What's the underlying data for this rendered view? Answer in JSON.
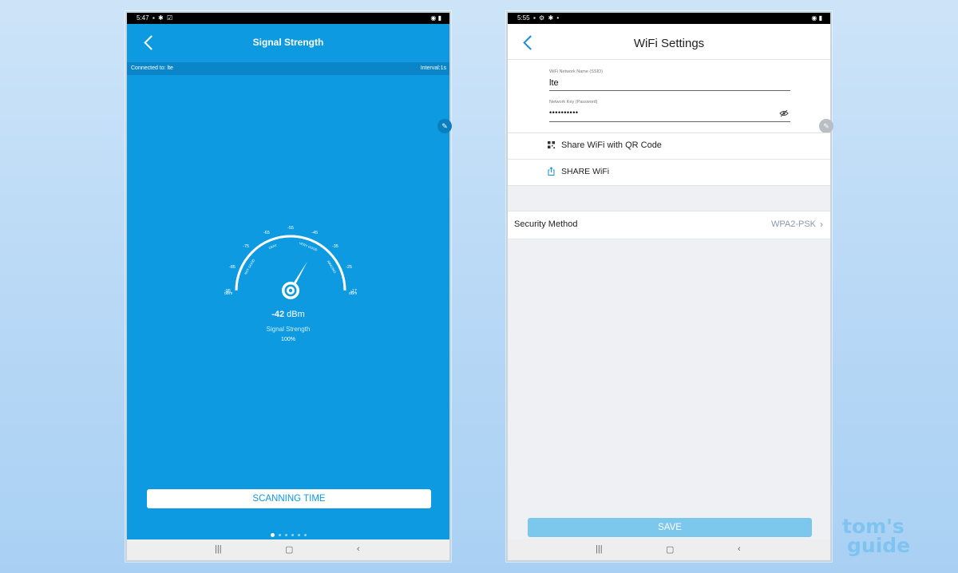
{
  "left_phone": {
    "status_time": "5:47",
    "title": "Signal Strength",
    "connected_label": "Connected to: lte",
    "interval_label": "Interval:1s",
    "gauge": {
      "value_number": "-42",
      "value_unit": "dBm",
      "caption": "Signal Strength",
      "percent": "100%",
      "needle_percent": 100,
      "tick_labels": [
        "-95",
        "-85",
        "-75",
        "-65",
        "-55",
        "-45",
        "-35",
        "-25",
        "-17"
      ],
      "end_unit_left": "dBm",
      "end_unit_right": "dBm",
      "zone_labels": [
        "NOT GOOD",
        "OKAY",
        "VERY GOOD",
        "AMAZING"
      ]
    },
    "scan_button": "SCANNING TIME",
    "page_indicator": {
      "count": 6,
      "active": 1
    },
    "colors": {
      "background": "#0d9ae0",
      "info_bar": "#0a86c8"
    }
  },
  "right_phone": {
    "status_time": "5:55",
    "title": "WiFi Settings",
    "ssid_label": "WiFi Network Name (SSID)",
    "ssid_value": "lte",
    "key_label": "Network Key (Password)",
    "key_value": "••••••••••",
    "share_qr": "Share WiFi with QR Code",
    "share_wifi": "SHARE WiFi",
    "security_label": "Security Method",
    "security_value": "WPA2-PSK",
    "save_button": "SAVE",
    "colors": {
      "accent": "#1a8fd6",
      "save": "#7cc7ec"
    }
  },
  "nav": {
    "recents": "|||",
    "home": "▢",
    "back": "‹"
  },
  "icons": {
    "back": "chevron-left-icon",
    "edit": "pencil-icon",
    "visibility": "eye-off-icon",
    "qr": "qr-code-icon",
    "share": "share-icon"
  },
  "brand": {
    "line1": "tom's",
    "line2": "guide"
  }
}
